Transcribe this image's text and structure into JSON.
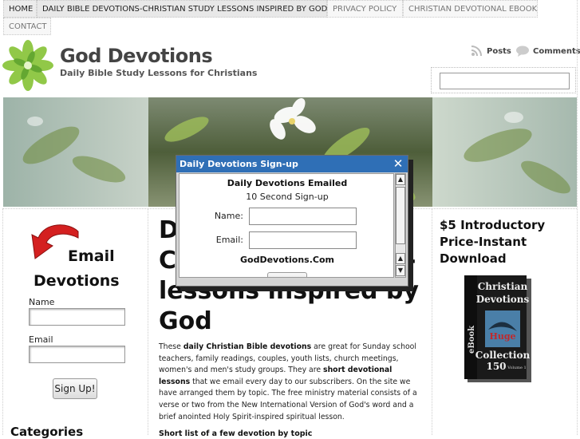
{
  "nav": {
    "items": [
      "HOME",
      "DAILY BIBLE DEVOTIONS-CHRISTIAN STUDY LESSONS INSPIRED BY GOD",
      "PRIVACY POLICY",
      "CHRISTIAN DEVOTIONAL EBOOK",
      "CONTACT"
    ]
  },
  "header": {
    "title": "God Devotions",
    "tagline": "Daily Bible Study Lessons for Christians",
    "feeds": {
      "posts": "Posts",
      "comments": "Comments"
    },
    "search": {
      "value": ""
    },
    "logo_icon": "green-flower-logo-icon"
  },
  "sidebar": {
    "email_word": "Email",
    "devotions_word": "Devotions",
    "name_label": "Name",
    "email_label": "Email",
    "signup_button": "Sign Up!",
    "categories_title": "Categories",
    "arrow_icon": "red-curved-arrow-icon"
  },
  "main": {
    "title_lines": [
      "D",
      "C",
      "lessons inspired by",
      "God"
    ],
    "title_right_fragments": [
      ".",
      "-"
    ],
    "body": {
      "p1": "These ",
      "b1": "daily Christian Bible devotions",
      "p2": " are great for Sunday school teachers, family readings, couples, youth lists, church meetings, women's and men's study groups. They are ",
      "b2": "short devotional lessons",
      "p3": " that we email every day to our subscribers. On the site we have arranged them by topic. The free ministry material consists of a verse or two from the New International Version of God's word and a brief anointed Holy Spirit-inspired spiritual lesson."
    },
    "short_list": "Short list of a few devotion by topic"
  },
  "right": {
    "promo": "$5 Introductory Price-Instant Download",
    "ebook": {
      "line1": "Christian",
      "line2": "Devotions",
      "huge": "Huge",
      "collection": "Collection",
      "count": "150",
      "volume": "Volume 1",
      "side": "eBook"
    }
  },
  "popup": {
    "title": "Daily Devotions Sign-up",
    "heading": "Daily Devotions Emailed",
    "subheading": "10 Second Sign-up",
    "name_label": "Name:",
    "email_label": "Email:",
    "site": "GodDevotions.Com",
    "close_icon": "close-x-icon"
  },
  "colors": {
    "popup_titlebar": "#2f6fb6",
    "arrow_red": "#d42020",
    "logo_green": "#7cc142"
  }
}
